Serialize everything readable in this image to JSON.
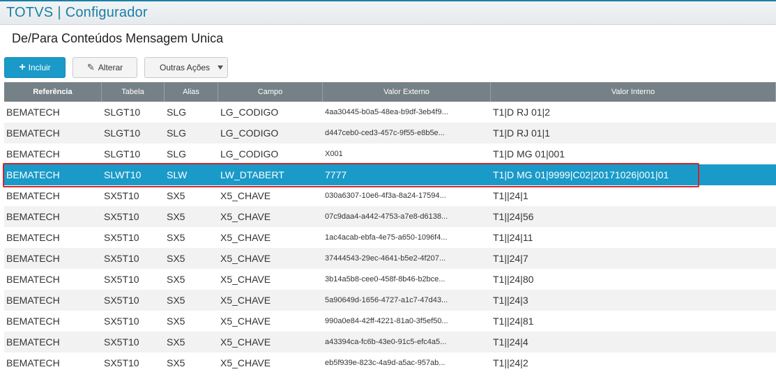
{
  "app": {
    "name": "TOTVS",
    "separator": "|",
    "module": "Configurador"
  },
  "page": {
    "title": "De/Para Conteúdos Mensagem Unica"
  },
  "toolbar": {
    "incluir_label": "Incluir",
    "alterar_label": "Alterar",
    "outras_label": "Outras Ações"
  },
  "colors": {
    "accent": "#1a9ac8",
    "header": "#758186",
    "highlight_border": "#d0262d",
    "title": "#1a7fa8"
  },
  "grid": {
    "columns": [
      "Referência",
      "Tabela",
      "Alias",
      "Campo",
      "Valor Externo",
      "Valor Interno"
    ],
    "rows": [
      [
        "BEMATECH",
        "SLGT10",
        "SLG",
        "LG_CODIGO",
        "4aa30445-b0a5-48ea-b9df-3eb4f9...",
        "T1|D RJ 01|2"
      ],
      [
        "BEMATECH",
        "SLGT10",
        "SLG",
        "LG_CODIGO",
        "d447ceb0-ced3-457c-9f55-e8b5e...",
        "T1|D RJ 01|1"
      ],
      [
        "BEMATECH",
        "SLGT10",
        "SLG",
        "LG_CODIGO",
        "X001",
        "T1|D MG 01|001"
      ],
      [
        "BEMATECH",
        "SLWT10",
        "SLW",
        "LW_DTABERT",
        "7777",
        "T1|D MG 01|9999|C02|20171026|001|01"
      ],
      [
        "BEMATECH",
        "SX5T10",
        "SX5",
        "X5_CHAVE",
        "030a6307-10e6-4f3a-8a24-17594...",
        "T1||24|1"
      ],
      [
        "BEMATECH",
        "SX5T10",
        "SX5",
        "X5_CHAVE",
        "07c9daa4-a442-4753-a7e8-d6138...",
        "T1||24|56"
      ],
      [
        "BEMATECH",
        "SX5T10",
        "SX5",
        "X5_CHAVE",
        "1ac4acab-ebfa-4e75-a650-1096f4...",
        "T1||24|11"
      ],
      [
        "BEMATECH",
        "SX5T10",
        "SX5",
        "X5_CHAVE",
        "37444543-29ec-4641-b5e2-4f207...",
        "T1||24|7"
      ],
      [
        "BEMATECH",
        "SX5T10",
        "SX5",
        "X5_CHAVE",
        "3b14a5b8-cee0-458f-8b46-b2bce...",
        "T1||24|80"
      ],
      [
        "BEMATECH",
        "SX5T10",
        "SX5",
        "X5_CHAVE",
        "5a90649d-1656-4727-a1c7-47d43...",
        "T1||24|3"
      ],
      [
        "BEMATECH",
        "SX5T10",
        "SX5",
        "X5_CHAVE",
        "990a0e84-42ff-4221-81a0-3f5ef50...",
        "T1||24|81"
      ],
      [
        "BEMATECH",
        "SX5T10",
        "SX5",
        "X5_CHAVE",
        "a43394ca-fc6b-43e0-91c5-efc4a5...",
        "T1||24|4"
      ],
      [
        "BEMATECH",
        "SX5T10",
        "SX5",
        "X5_CHAVE",
        "eb5f939e-823c-4a9d-a5ac-957ab...",
        "T1||24|2"
      ]
    ],
    "selected_row": 3
  }
}
